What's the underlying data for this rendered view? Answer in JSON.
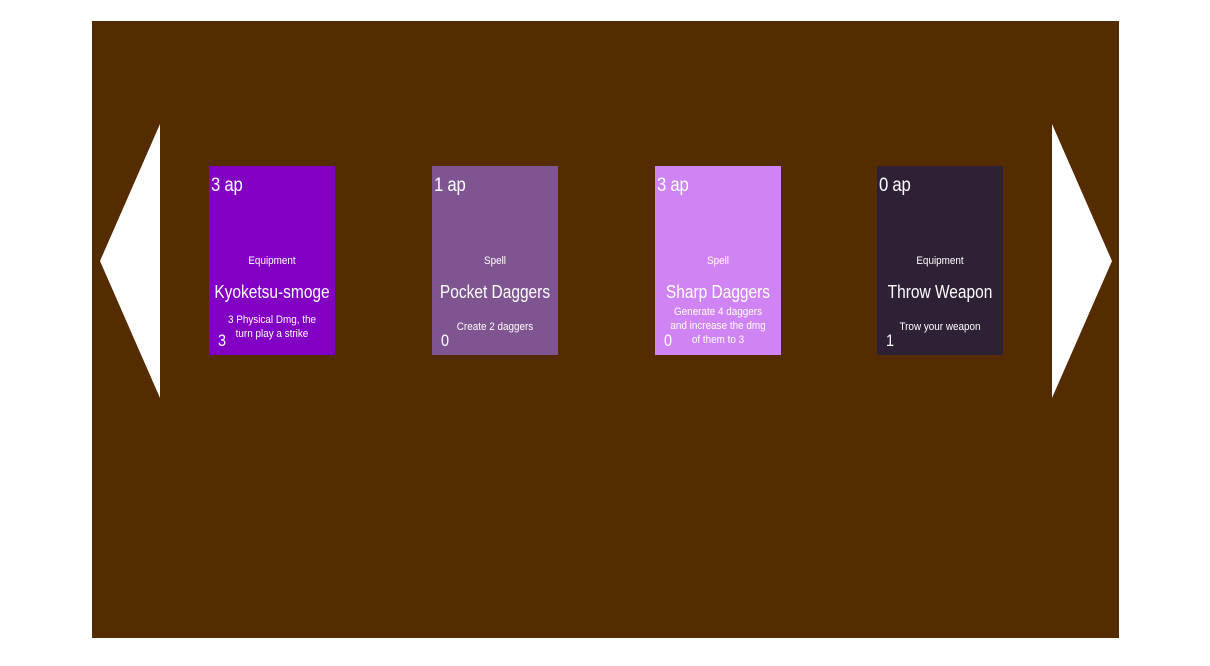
{
  "colors": {
    "background": "#552b00",
    "arrow": "#ffffff"
  },
  "nav": {
    "left_icon": "triangle-left-icon",
    "right_icon": "triangle-right-icon"
  },
  "cards": [
    {
      "ap": "3 ap",
      "type": "Equipment",
      "name": "Kyoketsu-smoge",
      "description": "3 Physical Dmg, the turn play a strike",
      "cost": "3",
      "color": "#8200c3"
    },
    {
      "ap": "1 ap",
      "type": "Spell",
      "name": "Pocket Daggers",
      "description": "Create 2 daggers",
      "cost": "0",
      "color": "#7e5491"
    },
    {
      "ap": "3 ap",
      "type": "Spell",
      "name": "Sharp Daggers",
      "description": "Generate 4 daggers and increase the dmg of them to 3",
      "cost": "0",
      "color": "#d084f3"
    },
    {
      "ap": "0 ap",
      "type": "Equipment",
      "name": "Throw Weapon",
      "description": "Trow your weapon",
      "cost": "1",
      "color": "#2e2035"
    }
  ]
}
